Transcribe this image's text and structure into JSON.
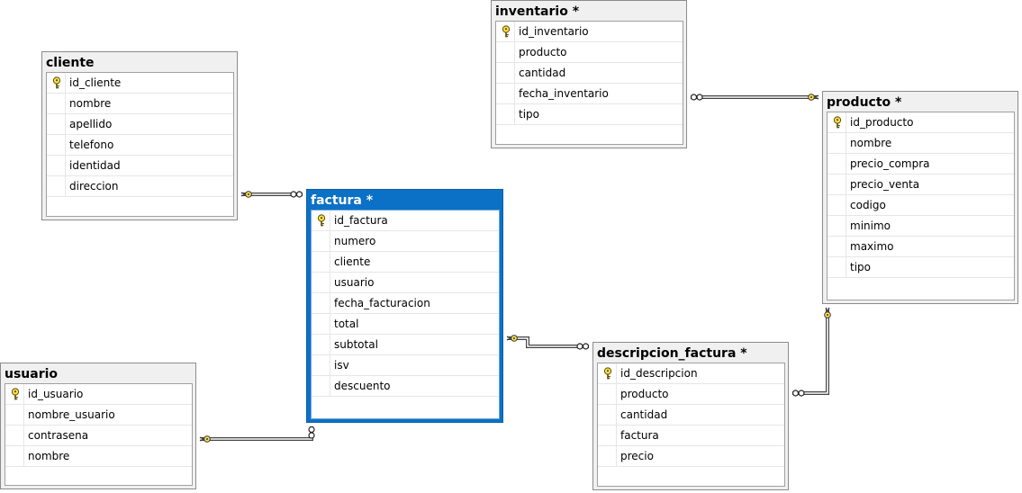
{
  "diagram": {
    "tables": [
      {
        "id": "cliente",
        "title": "cliente",
        "selected": false,
        "primary_key": "id_cliente",
        "columns": [
          "id_cliente",
          "nombre",
          "apellido",
          "telefono",
          "identidad",
          "direccion"
        ]
      },
      {
        "id": "inventario",
        "title": "inventario *",
        "selected": false,
        "primary_key": "id_inventario",
        "columns": [
          "id_inventario",
          "producto",
          "cantidad",
          "fecha_inventario",
          "tipo"
        ]
      },
      {
        "id": "producto",
        "title": "producto *",
        "selected": false,
        "primary_key": "id_producto",
        "columns": [
          "id_producto",
          "nombre",
          "precio_compra",
          "precio_venta",
          "codigo",
          "minimo",
          "maximo",
          "tipo"
        ]
      },
      {
        "id": "factura",
        "title": "factura *",
        "selected": true,
        "primary_key": "id_factura",
        "columns": [
          "id_factura",
          "numero",
          "cliente",
          "usuario",
          "fecha_facturacion",
          "total",
          "subtotal",
          "isv",
          "descuento"
        ]
      },
      {
        "id": "usuario",
        "title": "usuario",
        "selected": false,
        "primary_key": "id_usuario",
        "columns": [
          "id_usuario",
          "nombre_usuario",
          "contrasena",
          "nombre"
        ]
      },
      {
        "id": "descripcion_factura",
        "title": "descripcion_factura *",
        "selected": false,
        "primary_key": "id_descripcion",
        "columns": [
          "id_descripcion",
          "producto",
          "cantidad",
          "factura",
          "precio"
        ]
      }
    ],
    "relationships": [
      {
        "name": "factura-cliente",
        "one_side": "cliente",
        "many_side": "factura"
      },
      {
        "name": "inventario-producto",
        "one_side": "producto",
        "many_side": "inventario"
      },
      {
        "name": "factura-usuario",
        "one_side": "usuario",
        "many_side": "factura"
      },
      {
        "name": "descripcion-factura",
        "one_side": "factura",
        "many_side": "descripcion_factura"
      },
      {
        "name": "descripcion-producto",
        "one_side": "producto",
        "many_side": "descripcion_factura"
      }
    ]
  },
  "icons": {
    "primary_key": "key-icon",
    "one_end": "key-end-icon",
    "many_end": "infinity-end-icon"
  },
  "colors": {
    "selected_header": "#0b71c7",
    "key_fill": "#ffe24a",
    "connector": "#444444"
  }
}
